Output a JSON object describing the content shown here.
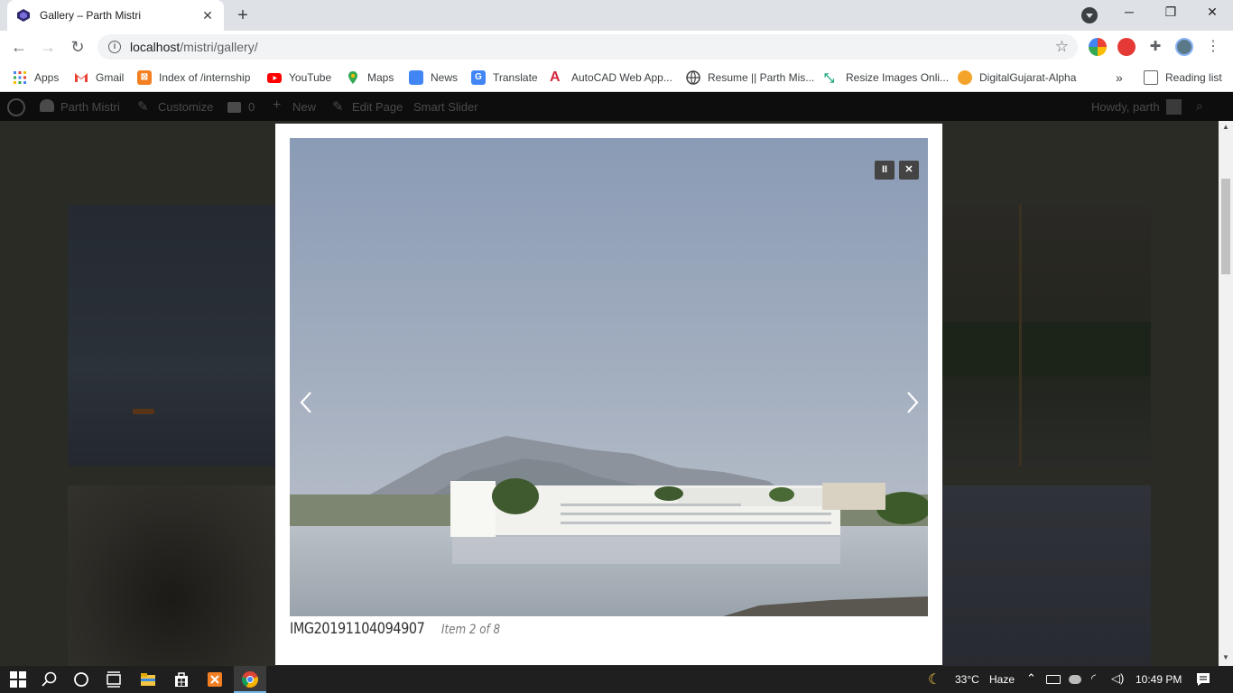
{
  "browser": {
    "tab_title": "Gallery – Parth Mistri",
    "url_host": "localhost",
    "url_path": "/mistri/gallery/"
  },
  "bookmarks": [
    {
      "label": "Apps",
      "color": "#4285f4"
    },
    {
      "label": "Gmail",
      "color": "#ea4335"
    },
    {
      "label": "Index of /internship",
      "color": "#f37f22"
    },
    {
      "label": "YouTube",
      "color": "#ff0000"
    },
    {
      "label": "Maps",
      "color": "#34a853"
    },
    {
      "label": "News",
      "color": "#4285f4"
    },
    {
      "label": "Translate",
      "color": "#4285f4"
    },
    {
      "label": "AutoCAD Web App...",
      "color": "#d7263d"
    },
    {
      "label": "Resume || Parth Mis...",
      "color": "#444444"
    },
    {
      "label": "Resize Images Onli...",
      "color": "#22a884"
    },
    {
      "label": "DigitalGujarat-Alpha",
      "color": "#f4a42a"
    },
    {
      "label": "»",
      "color": ""
    },
    {
      "label": "Reading list",
      "color": "#5f6368"
    }
  ],
  "wpbar": {
    "site": "Parth Mistri",
    "customize": "Customize",
    "comments": "0",
    "new": "New",
    "edit": "Edit Page",
    "slider": "Smart Slider",
    "howdy": "Howdy, parth"
  },
  "lightbox": {
    "image_title": "IMG20191104094907",
    "item_count": "Item 2 of 8",
    "pause_label": "II",
    "close_label": "✕"
  },
  "taskbar": {
    "temperature": "33°C",
    "weather": "Haze",
    "time": "10:49 PM"
  }
}
